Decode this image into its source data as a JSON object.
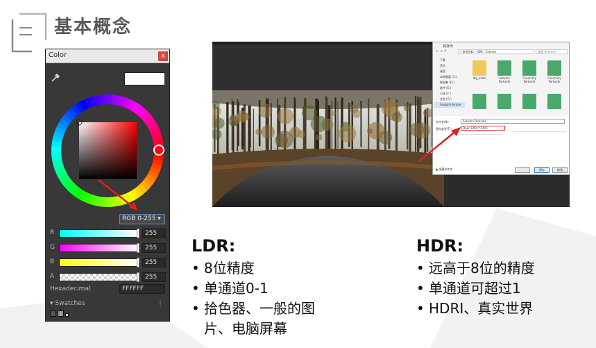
{
  "title": "基本概念",
  "color_picker": {
    "tab": "Color",
    "close": "x",
    "mode": "RGB 0-255",
    "channels": [
      {
        "label": "R",
        "value": "255"
      },
      {
        "label": "G",
        "value": "255"
      },
      {
        "label": "B",
        "value": "255"
      },
      {
        "label": "A",
        "value": "255"
      }
    ],
    "hex_label": "Hexadecimal",
    "hex_value": "FFFFFF",
    "swatches_label": "Swatches",
    "swatches_more": "⋮",
    "current_color": "#ffffff"
  },
  "dialog": {
    "title": "另存为",
    "path": "« 参考资料 › HDR › Exterior",
    "search": "搜索\"Exterior\"",
    "sidebar": [
      "下载",
      "音乐",
      "桌面",
      "本地磁盘 (C:)",
      "新加卷 (D:)",
      "软件 (E:)",
      "小说 (F:)",
      "文档 (G:)",
      "Seagate Expan"
    ],
    "files": [
      "dlg_meta",
      "Autumn Parkside",
      "Cloud Sky Parkside",
      "Cloud Sky Parkside",
      "",
      "",
      "",
      ""
    ],
    "filename_label": "文件名(N):",
    "filename_value": "Autumn Parkside",
    "filetype_label": "保存类型(T):",
    "filetype_value": "Open EXR (*.EXR)",
    "save_label": "保存",
    "cancel_label": "取消",
    "hide_label": "▲ 隐藏文件夹"
  },
  "ldr": {
    "heading": "LDR:",
    "items": [
      "8位精度",
      "单通道0-1",
      "拾色器、一般的图",
      "片、电脑屏幕"
    ]
  },
  "hdr": {
    "heading": "HDR:",
    "items": [
      "远高于8位的精度",
      "单通道可超过1",
      "HDRI、真实世界"
    ]
  },
  "bullet_char": "•"
}
